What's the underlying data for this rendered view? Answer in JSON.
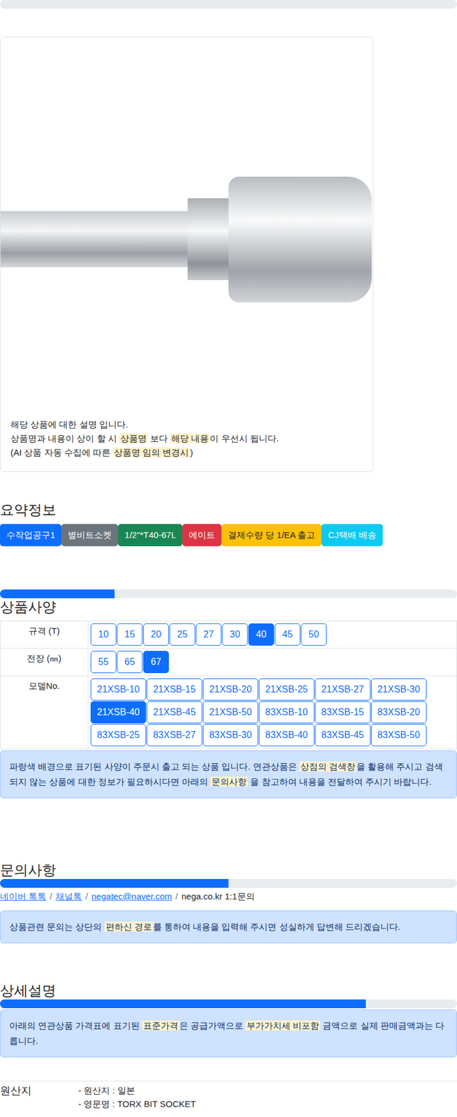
{
  "product_card": {
    "notes": [
      [
        {
          "text": "해당 상품에 대한 설명 입니다.",
          "mark": false
        }
      ],
      [
        {
          "text": "상품명과 내용이 상이 할 시 ",
          "mark": false
        },
        {
          "text": "상품명",
          "mark": true
        },
        {
          "text": " 보다 ",
          "mark": false
        },
        {
          "text": "해당 내용",
          "mark": true
        },
        {
          "text": "이 우선시 됩니다.",
          "mark": false
        }
      ],
      [
        {
          "text": "(AI 상품 자동 수집에 따른 ",
          "mark": false
        },
        {
          "text": "상품명 임의 변경시",
          "mark": true
        },
        {
          "text": ")",
          "mark": false
        }
      ]
    ]
  },
  "summary": {
    "title": "요약정보",
    "tags": [
      {
        "label": "수작업공구1",
        "color": "#0d6efd"
      },
      {
        "label": "별비트소켓",
        "color": "#6c757d"
      },
      {
        "label": "1/2\"*T40-67L",
        "color": "#198754"
      },
      {
        "label": "에이트",
        "color": "#dc3545"
      },
      {
        "label": "결제수량 당 1/EA 출고",
        "color": "#ffc107"
      },
      {
        "label": "CJ택배 배송",
        "color": "#0dcaf0"
      }
    ]
  },
  "specs": {
    "title": "상품사양",
    "level": 0.25,
    "rows": [
      {
        "label": "규격 (T)",
        "options": [
          {
            "label": "10",
            "selected": false
          },
          {
            "label": "15",
            "selected": false
          },
          {
            "label": "20",
            "selected": false
          },
          {
            "label": "25",
            "selected": false
          },
          {
            "label": "27",
            "selected": false
          },
          {
            "label": "30",
            "selected": false
          },
          {
            "label": "40",
            "selected": true
          },
          {
            "label": "45",
            "selected": false
          },
          {
            "label": "50",
            "selected": false
          }
        ]
      },
      {
        "label": "전장 (㎜)",
        "options": [
          {
            "label": "55",
            "selected": false
          },
          {
            "label": "65",
            "selected": false
          },
          {
            "label": "67",
            "selected": true
          }
        ]
      },
      {
        "label": "모델No.",
        "options": [
          {
            "label": "21XSB-10",
            "selected": false
          },
          {
            "label": "21XSB-15",
            "selected": false
          },
          {
            "label": "21XSB-20",
            "selected": false
          },
          {
            "label": "21XSB-25",
            "selected": false
          },
          {
            "label": "21XSB-27",
            "selected": false
          },
          {
            "label": "21XSB-30",
            "selected": false
          },
          {
            "label": "21XSB-40",
            "selected": true
          },
          {
            "label": "21XSB-45",
            "selected": false
          },
          {
            "label": "21XSB-50",
            "selected": false
          },
          {
            "label": "83XSB-10",
            "selected": false
          },
          {
            "label": "83XSB-15",
            "selected": false
          },
          {
            "label": "83XSB-20",
            "selected": false
          },
          {
            "label": "83XSB-25",
            "selected": false
          },
          {
            "label": "83XSB-27",
            "selected": false
          },
          {
            "label": "83XSB-30",
            "selected": false
          },
          {
            "label": "83XSB-40",
            "selected": false
          },
          {
            "label": "83XSB-45",
            "selected": false
          },
          {
            "label": "83XSB-50",
            "selected": false
          }
        ]
      }
    ],
    "notice": [
      {
        "text": "파랑색 배경으로 표기된 사양이 주문시 출고 되는 상품 입니다. 연관상품은 ",
        "mark": false
      },
      {
        "text": "상점의 검색창",
        "mark": true
      },
      {
        "text": "을 활용해 주시고 검색되지 않는 상품에 대한 정보가 필요하시다면 아래의 ",
        "mark": false
      },
      {
        "text": "문의사항",
        "mark": true
      },
      {
        "text": " 을 참고하여 내용을 전달하여 주시기 바랍니다.",
        "mark": false
      }
    ]
  },
  "inquiry": {
    "title": "문의사항",
    "level": 0.5,
    "separator": "/",
    "links": [
      {
        "label": "네이버 톡톡",
        "link": true
      },
      {
        "label": "채널톡",
        "link": true
      },
      {
        "label": "negatec@naver.com",
        "link": true
      },
      {
        "label": "nega.co.kr 1:1문의",
        "link": false
      }
    ],
    "notice": [
      {
        "text": "상품관련 문의는 상단의 ",
        "mark": false
      },
      {
        "text": "편하신 경로",
        "mark": true
      },
      {
        "text": "를 통하여 내용을 입력해 주시면 성실하게 답변해 드리겠습니다.",
        "mark": false
      }
    ]
  },
  "detail": {
    "title": "상세설명",
    "level": 0.8,
    "notice": [
      {
        "text": "아래의 연관상품 가격표에 표기된 ",
        "mark": false
      },
      {
        "text": "표준가격",
        "mark": true
      },
      {
        "text": "은 공급가액으로 ",
        "mark": false
      },
      {
        "text": "부가가치세 비포함",
        "mark": true
      },
      {
        "text": " 금액으로 실제 판매금액과는 다릅니다.",
        "mark": false
      }
    ],
    "origin": {
      "label": "원산지",
      "lines": [
        "- 원산지 : 일본",
        "- 영문명 : TORX BIT SOCKET"
      ]
    }
  }
}
